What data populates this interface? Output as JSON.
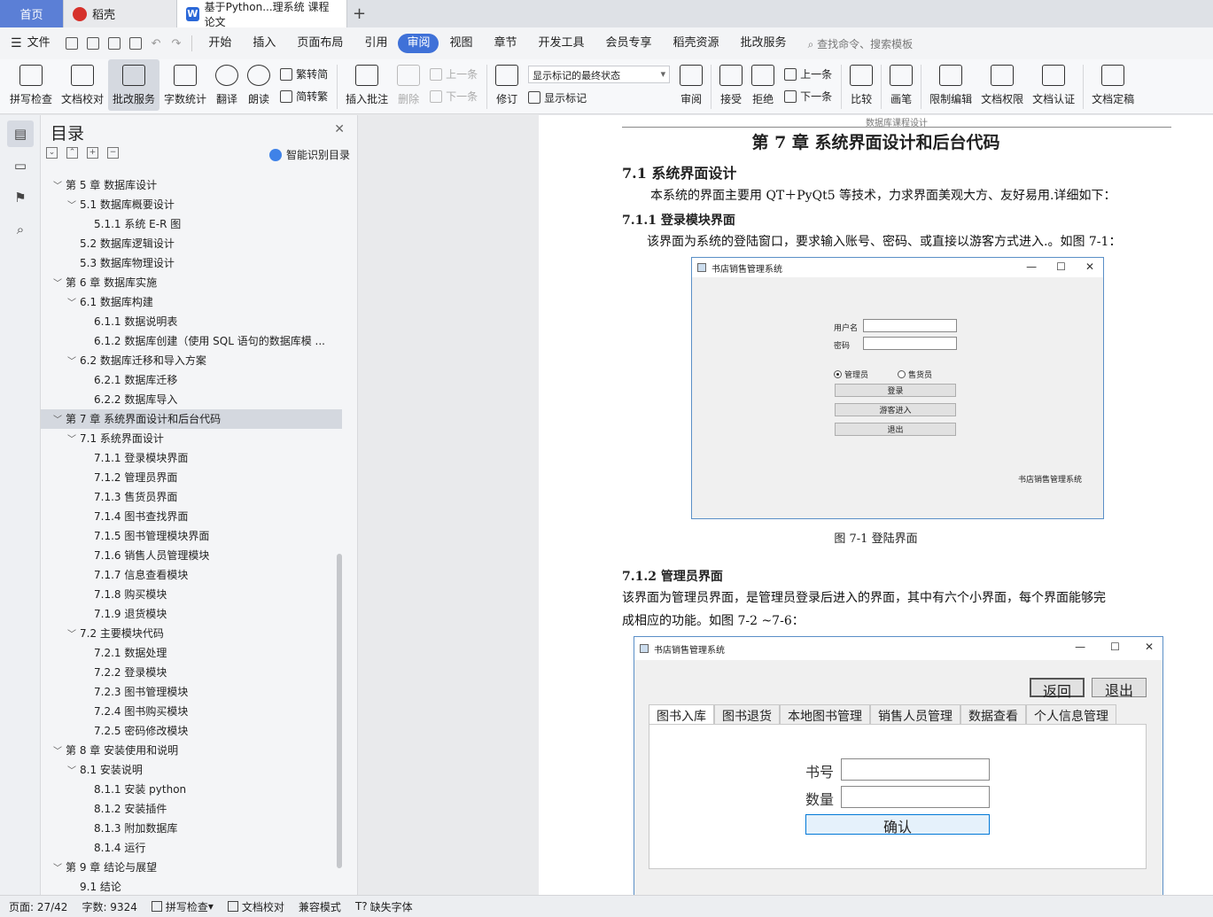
{
  "tabs": {
    "home": "首页",
    "daoke": "稻壳",
    "doc": "基于Python...理系统 课程论文"
  },
  "menu": {
    "file": "文件",
    "items": [
      "开始",
      "插入",
      "页面布局",
      "引用",
      "审阅",
      "视图",
      "章节",
      "开发工具",
      "会员专享",
      "稻壳资源",
      "批改服务"
    ],
    "active_index": 4,
    "search_hint": "查找命令、搜索模板"
  },
  "ribbon": {
    "spell": "拼写检查",
    "proof": "文档校对",
    "correct": "批改服务",
    "wordcount": "字数统计",
    "translate": "翻译",
    "read": "朗读",
    "trad_simp": "繁转简",
    "simp_trad": "简转繁",
    "insert_comment": "插入批注",
    "delete": "删除",
    "prev": "上一条",
    "next": "下一条",
    "revise": "修订",
    "markup_state": "显示标记的最终状态",
    "show_markup": "显示标记",
    "review": "审阅",
    "accept": "接受",
    "reject": "拒绝",
    "prev2": "上一条",
    "next2": "下一条",
    "compare": "比较",
    "pen": "画笔",
    "restrict": "限制编辑",
    "perm": "文档权限",
    "cert": "文档认证",
    "final": "文档定稿"
  },
  "toc": {
    "title": "目录",
    "smart": "智能识别目录",
    "items": [
      {
        "level": 1,
        "text": "第 5 章  数据库设计",
        "arrow": "﹀"
      },
      {
        "level": 2,
        "text": "5.1  数据库概要设计",
        "arrow": "﹀"
      },
      {
        "level": 3,
        "text": "5.1.1 系统 E-R 图",
        "arrow": ""
      },
      {
        "level": 2,
        "text": "5.2 数据库逻辑设计",
        "arrow": ""
      },
      {
        "level": 2,
        "text": "5.3  数据库物理设计",
        "arrow": ""
      },
      {
        "level": 1,
        "text": "第 6 章  数据库实施",
        "arrow": "﹀"
      },
      {
        "level": 2,
        "text": "6.1  数据库构建",
        "arrow": "﹀"
      },
      {
        "level": 3,
        "text": "6.1.1  数据说明表",
        "arrow": ""
      },
      {
        "level": 3,
        "text": "6.1.2  数据库创建（使用 SQL 语句的数据库模 ...",
        "arrow": ""
      },
      {
        "level": 2,
        "text": "6.2  数据库迁移和导入方案",
        "arrow": "﹀"
      },
      {
        "level": 3,
        "text": "6.2.1 数据库迁移",
        "arrow": ""
      },
      {
        "level": 3,
        "text": "6.2.2 数据库导入",
        "arrow": ""
      },
      {
        "level": 1,
        "text": "第 7 章  系统界面设计和后台代码",
        "arrow": "﹀",
        "active": true
      },
      {
        "level": 2,
        "text": "7.1  系统界面设计",
        "arrow": "﹀"
      },
      {
        "level": 3,
        "text": "7.1.1  登录模块界面",
        "arrow": ""
      },
      {
        "level": 3,
        "text": "7.1.2  管理员界面",
        "arrow": ""
      },
      {
        "level": 3,
        "text": "7.1.3 售货员界面",
        "arrow": ""
      },
      {
        "level": 3,
        "text": "7.1.4 图书查找界面",
        "arrow": ""
      },
      {
        "level": 3,
        "text": "7.1.5  图书管理模块界面",
        "arrow": ""
      },
      {
        "level": 3,
        "text": "7.1.6  销售人员管理模块",
        "arrow": ""
      },
      {
        "level": 3,
        "text": "7.1.7  信息查看模块",
        "arrow": ""
      },
      {
        "level": 3,
        "text": "7.1.8  购买模块",
        "arrow": ""
      },
      {
        "level": 3,
        "text": "7.1.9  退货模块",
        "arrow": ""
      },
      {
        "level": 2,
        "text": "7.2  主要模块代码",
        "arrow": "﹀"
      },
      {
        "level": 3,
        "text": "7.2.1  数据处理",
        "arrow": ""
      },
      {
        "level": 3,
        "text": "7.2.2  登录模块",
        "arrow": ""
      },
      {
        "level": 3,
        "text": "7.2.3  图书管理模块",
        "arrow": ""
      },
      {
        "level": 3,
        "text": "7.2.4  图书购买模块",
        "arrow": ""
      },
      {
        "level": 3,
        "text": "7.2.5  密码修改模块",
        "arrow": ""
      },
      {
        "level": 1,
        "text": "第 8 章  安装使用和说明",
        "arrow": "﹀"
      },
      {
        "level": 2,
        "text": "8.1 安装说明",
        "arrow": "﹀"
      },
      {
        "level": 3,
        "text": "8.1.1 安装 python",
        "arrow": ""
      },
      {
        "level": 3,
        "text": "8.1.2 安装插件",
        "arrow": ""
      },
      {
        "level": 3,
        "text": "8.1.3 附加数据库",
        "arrow": ""
      },
      {
        "level": 3,
        "text": "8.1.4 运行",
        "arrow": ""
      },
      {
        "level": 1,
        "text": "第 9 章  结论与展望",
        "arrow": "﹀"
      },
      {
        "level": 2,
        "text": "9.1  结论",
        "arrow": ""
      }
    ]
  },
  "doc": {
    "header": "数据库课程设计",
    "chapter": "第 7 章  系统界面设计和后台代码",
    "s71": "7.1  系统界面设计",
    "p1": "本系统的界面主要用 QT＋PyQt5 等技术，力求界面美观大方、友好易用.详细如下：",
    "s711": "7.1.1  登录模块界面",
    "p2": "该界面为系统的登陆窗口，要求输入账号、密码、或直接以游客方式进入.。如图 7-1：",
    "caption1": "图 7-1  登陆界面",
    "s712": "7.1.2  管理员界面",
    "p3a": "该界面为管理员界面，是管理员登录后进入的界面，其中有六个小界面，每个界面能够完",
    "p3b": "成相应的功能。如图 7-2 ~7-6："
  },
  "login_win": {
    "title": "书店销售管理系统",
    "user_label": "用户名",
    "pwd_label": "密码",
    "radio_admin": "管理员",
    "radio_seller": "售货员",
    "btn_login": "登录",
    "btn_guest": "游客进入",
    "btn_exit": "退出",
    "footer": "书店销售管理系统"
  },
  "admin_win": {
    "title": "书店销售管理系统",
    "btn_back": "返回",
    "btn_exit": "退出",
    "tabs": [
      "图书入库",
      "图书退货",
      "本地图书管理",
      "销售人员管理",
      "数据查看",
      "个人信息管理"
    ],
    "label_isbn": "书号",
    "label_qty": "数量",
    "btn_confirm": "确认"
  },
  "status": {
    "page": "页面: 27/42",
    "words": "字数: 9324",
    "spell": "拼写检查",
    "proof": "文档校对",
    "compat": "兼容模式",
    "missing_font": "缺失字体"
  }
}
